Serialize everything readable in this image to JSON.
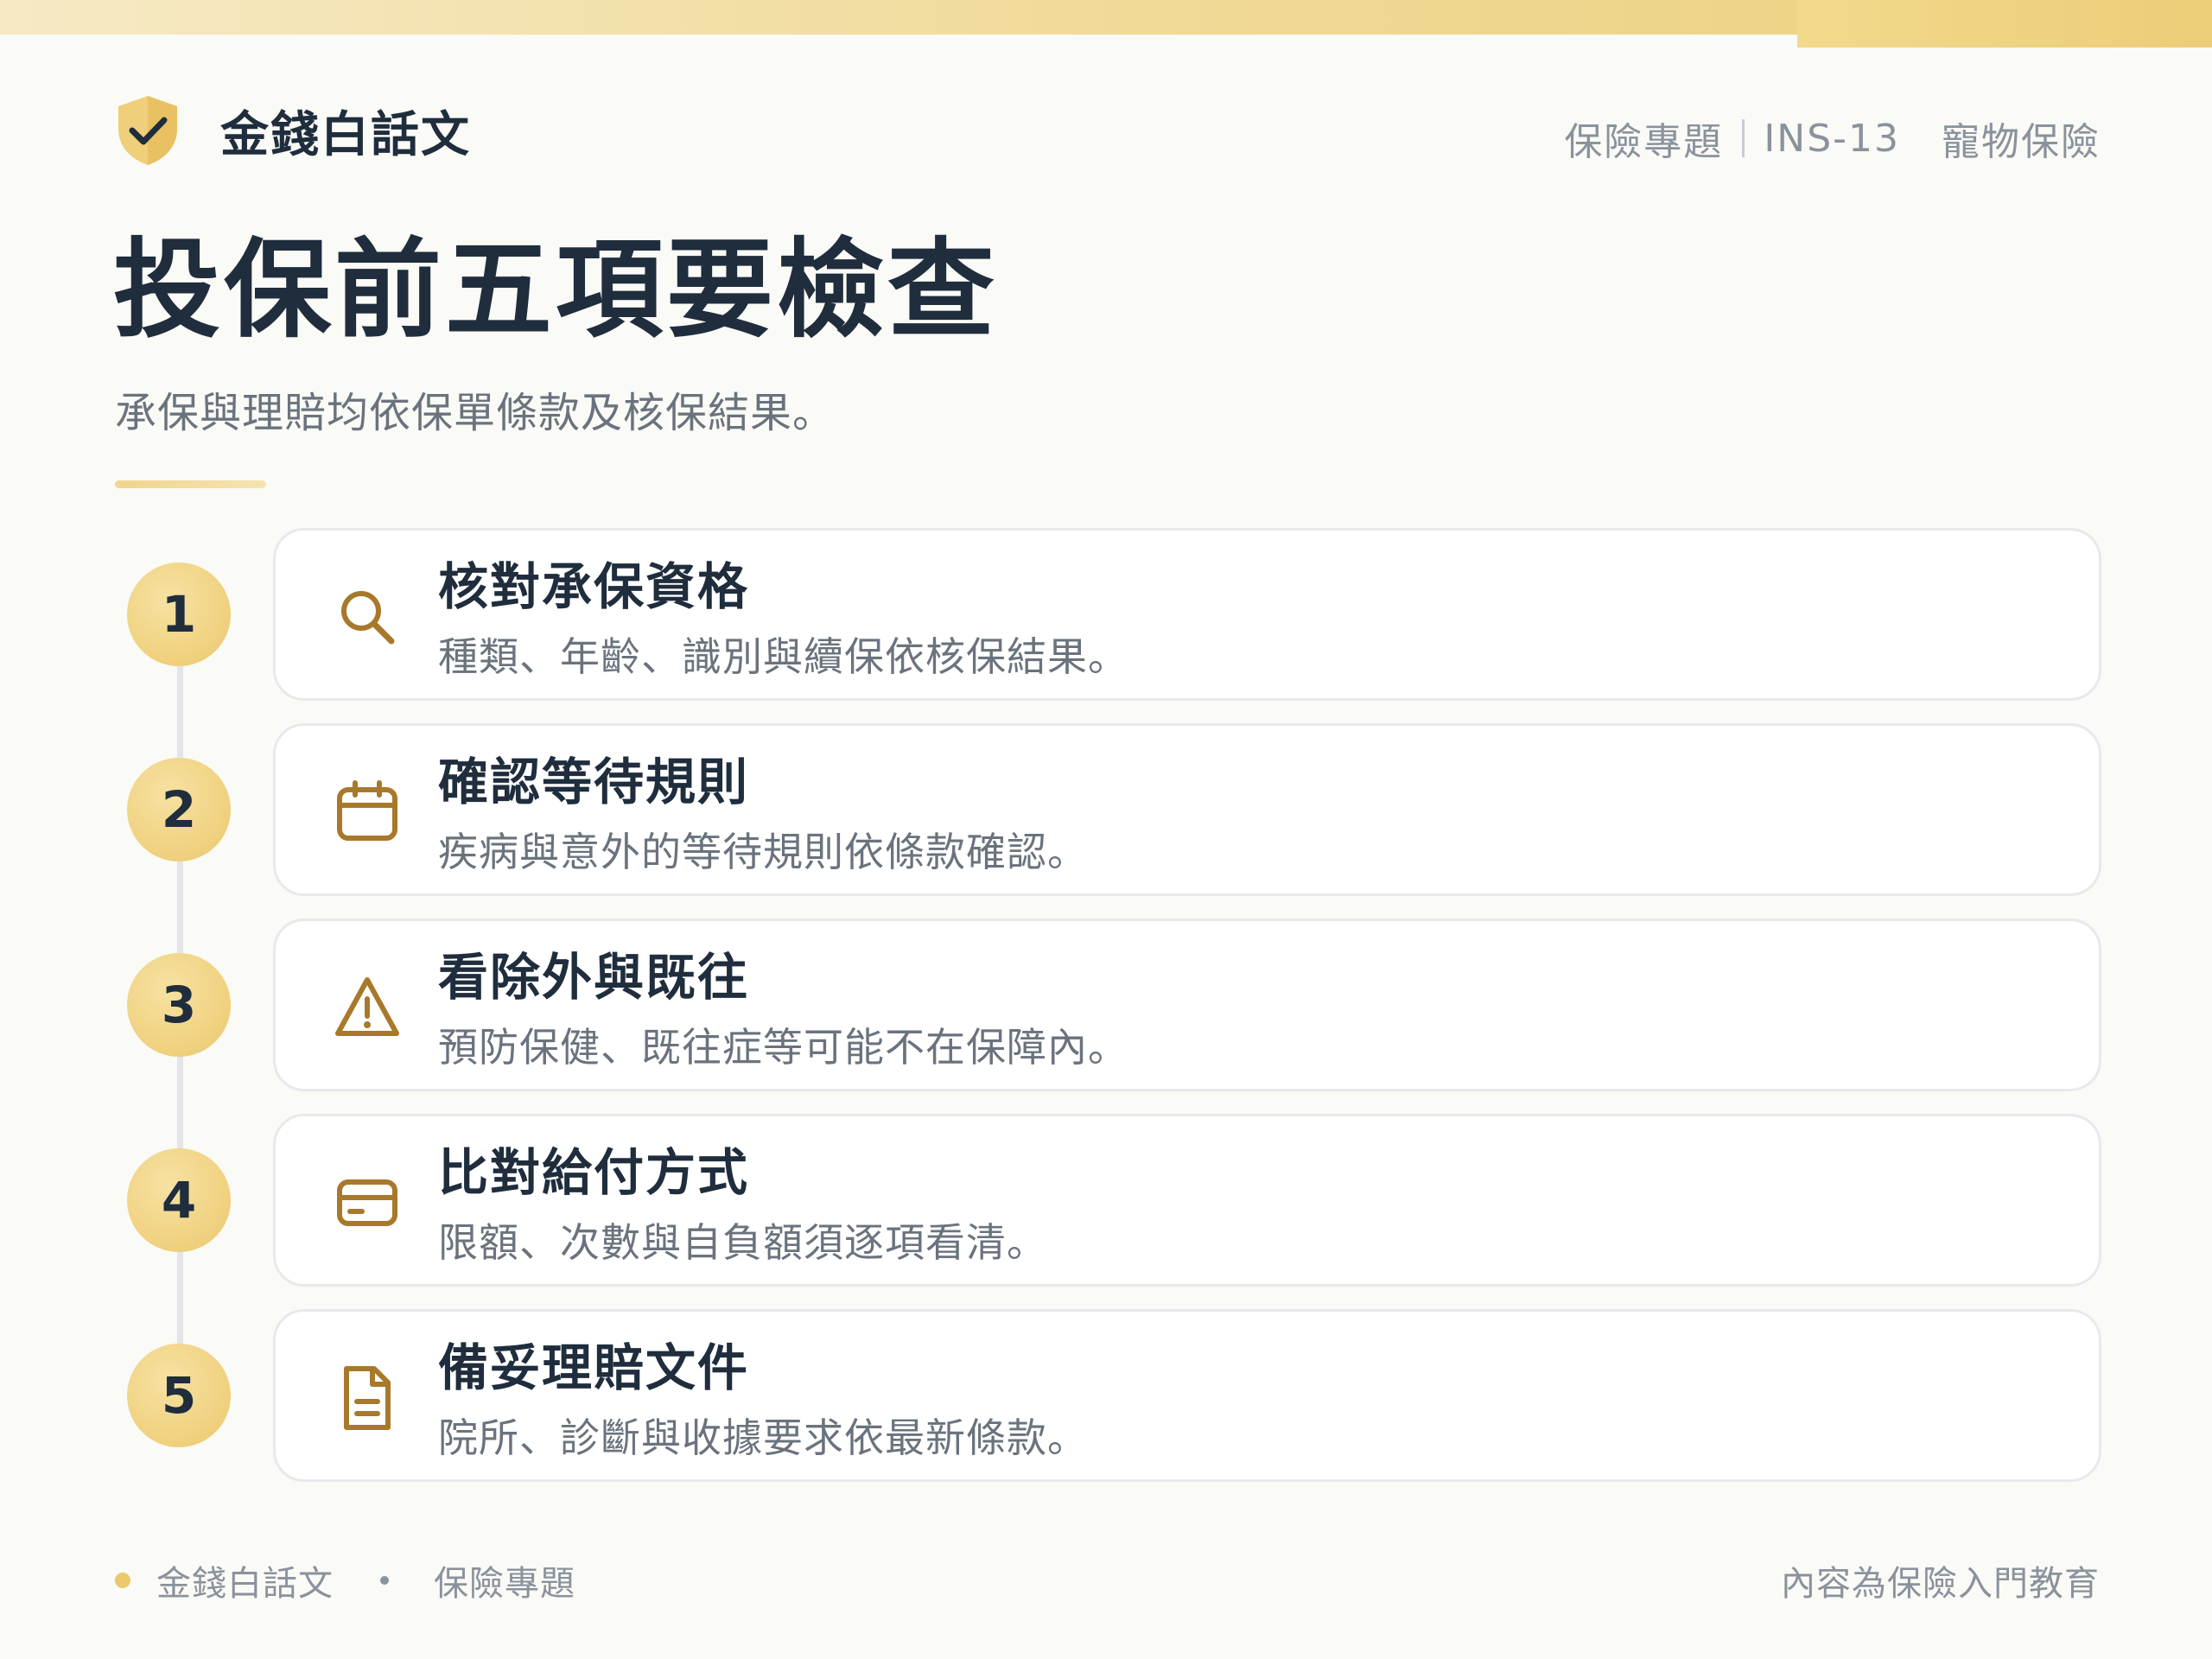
{
  "brand": {
    "name": "金錢白話文",
    "icon": "shield-check-icon"
  },
  "header": {
    "category": "保險專題",
    "code": "INS-13",
    "topic": "寵物保險"
  },
  "title": "投保前五項要檢查",
  "subtitle": "承保與理賠均依保單條款及核保結果。",
  "colors": {
    "accent": "#efd07d",
    "icon": "#a8792a",
    "text": "#1f2d3d",
    "muted": "#6a737d"
  },
  "steps": [
    {
      "number": "1",
      "icon": "search-icon",
      "title": "核對承保資格",
      "desc": "種類、年齡、識別與續保依核保結果。"
    },
    {
      "number": "2",
      "icon": "calendar-icon",
      "title": "確認等待規則",
      "desc": "疾病與意外的等待規則依條款確認。"
    },
    {
      "number": "3",
      "icon": "warning-icon",
      "title": "看除外與既往",
      "desc": "預防保健、既往症等可能不在保障內。"
    },
    {
      "number": "4",
      "icon": "credit-card-icon",
      "title": "比對給付方式",
      "desc": "限額、次數與自負額須逐項看清。"
    },
    {
      "number": "5",
      "icon": "document-icon",
      "title": "備妥理賠文件",
      "desc": "院所、診斷與收據要求依最新條款。"
    }
  ],
  "footer": {
    "brand": "金錢白話文",
    "category": "保險專題",
    "note": "內容為保險入門教育"
  }
}
